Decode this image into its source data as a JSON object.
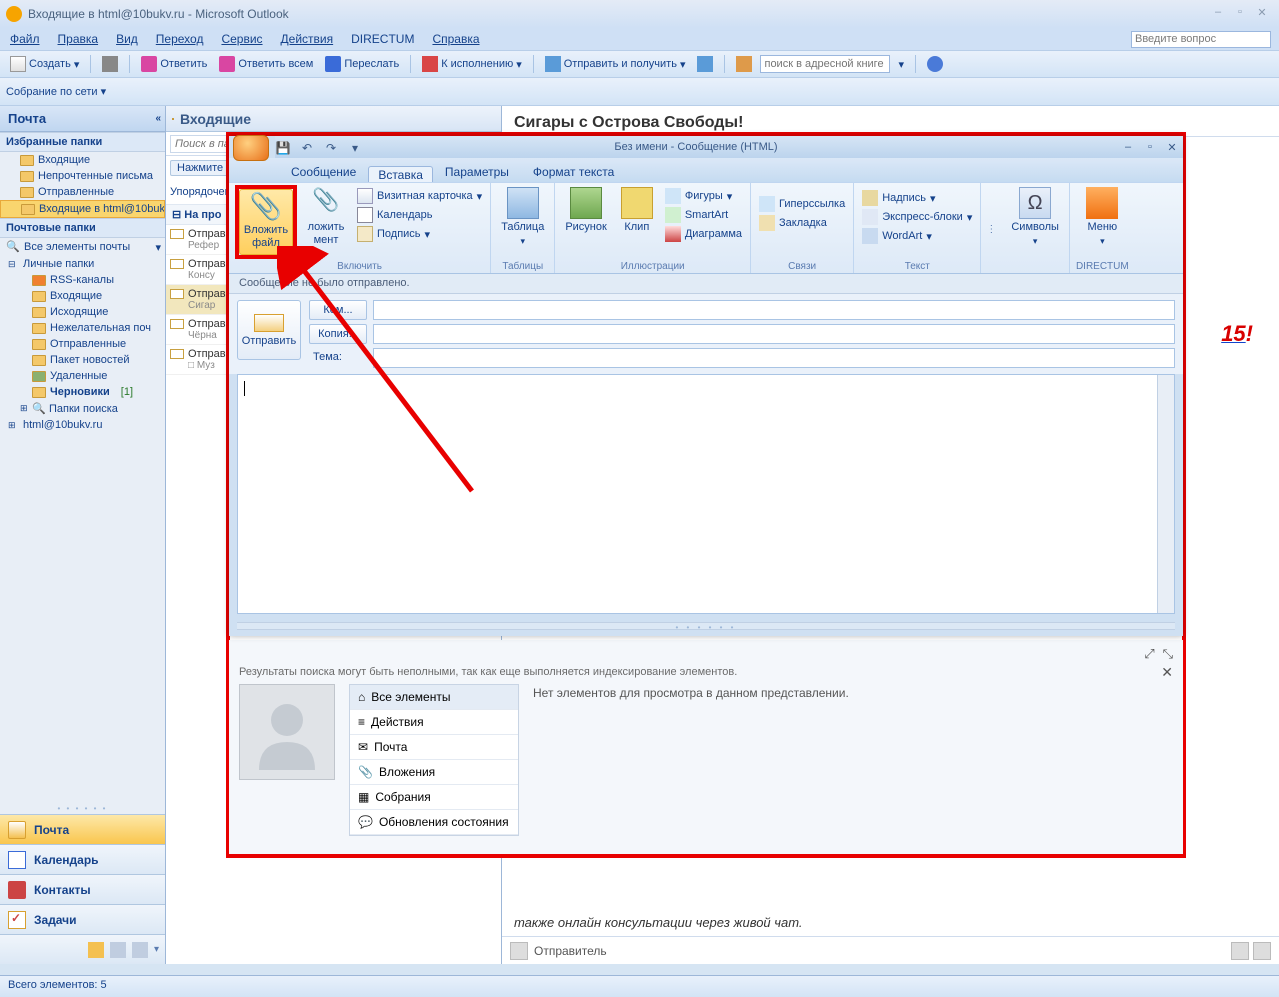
{
  "titlebar": {
    "text": "Входящие в html@10bukv.ru - Microsoft Outlook"
  },
  "menu": {
    "file": "Файл",
    "edit": "Правка",
    "view": "Вид",
    "go": "Переход",
    "service": "Сервис",
    "actions": "Действия",
    "directum": "DIRECTUM",
    "help": "Справка",
    "helpbox": "Введите вопрос"
  },
  "toolbar": {
    "create": "Создать",
    "reply": "Ответить",
    "replyall": "Ответить всем",
    "forward": "Переслать",
    "followup": "К исполнению",
    "sendrecv": "Отправить и получить",
    "addrsearch": "поиск в адресной книге",
    "meeting": "Собрание по сети"
  },
  "nav": {
    "header": "Почта",
    "fav_title": "Избранные папки",
    "fav_items": [
      "Входящие",
      "Непрочтенные письма",
      "Отправленные",
      "Входящие в html@10buk"
    ],
    "mail_title": "Почтовые папки",
    "all": "Все элементы почты",
    "personal": "Личные папки",
    "tree": [
      "RSS-каналы",
      "Входящие",
      "Исходящие",
      "Нежелательная поч",
      "Отправленные",
      "Пакет новостей",
      "Удаленные"
    ],
    "drafts": "Черновики",
    "drafts_count": "[1]",
    "search": "Папки поиска",
    "account": "html@10bukv.ru",
    "big": {
      "mail": "Почта",
      "cal": "Календарь",
      "cont": "Контакты",
      "task": "Задачи"
    }
  },
  "mid": {
    "header": "Входящие",
    "search_ph": "Поиск в папке \"Входящие\"",
    "hint": "Нажмите",
    "arrange": "Упорядочен",
    "group1": "На про",
    "items": [
      {
        "l1": "Отправ",
        "l2": "Рефер"
      },
      {
        "l1": "Отправ",
        "l2": "Консу"
      },
      {
        "l1": "Отправ",
        "l2": "Сигар"
      },
      {
        "l1": "Отправ",
        "l2": "Чёрна"
      },
      {
        "l1": "Отправ",
        "l2": "□ Муз"
      }
    ]
  },
  "read": {
    "subject": "Сигары с Острова Свободы!",
    "frag_suffix": "15",
    "frag_bang": "!",
    "frag2": "также онлайн консультации через живой чат.",
    "sender": "Отправитель"
  },
  "compose": {
    "title": "Без имени - Сообщение (HTML)",
    "tabs": {
      "msg": "Сообщение",
      "insert": "Вставка",
      "options": "Параметры",
      "format": "Формат текста"
    },
    "ribbon": {
      "attach_file": "Вложить файл",
      "attach_item": "ложить мент",
      "card": "Визитная карточка",
      "calendar": "Календарь",
      "signature": "Подпись",
      "group_include": "Включить",
      "table": "Таблица",
      "group_tables": "Таблицы",
      "picture": "Рисунок",
      "clip": "Клип",
      "shapes": "Фигуры",
      "smartart": "SmartArt",
      "diagram": "Диаграмма",
      "group_illustr": "Иллюстрации",
      "hyperlink": "Гиперссылка",
      "bookmark": "Закладка",
      "group_links": "Связи",
      "textbox": "Надпись",
      "quick": "Экспресс-блоки",
      "wordart": "WordArt",
      "group_text": "Текст",
      "symbols": "Символы",
      "menu": "Меню",
      "group_directum": "DIRECTUM"
    },
    "info": "Сообщение не было отправлено.",
    "send": "Отправить",
    "to": "Ком...",
    "cc": "Копия...",
    "subj": "Тема:"
  },
  "lower": {
    "note": "Результаты поиска могут быть неполными, так как еще выполняется индексирование элементов.",
    "empty": "Нет элементов для просмотра в данном представлении.",
    "tabs": [
      "Все элементы",
      "Действия",
      "Почта",
      "Вложения",
      "Собрания",
      "Обновления состояния"
    ]
  },
  "status": "Всего элементов: 5"
}
